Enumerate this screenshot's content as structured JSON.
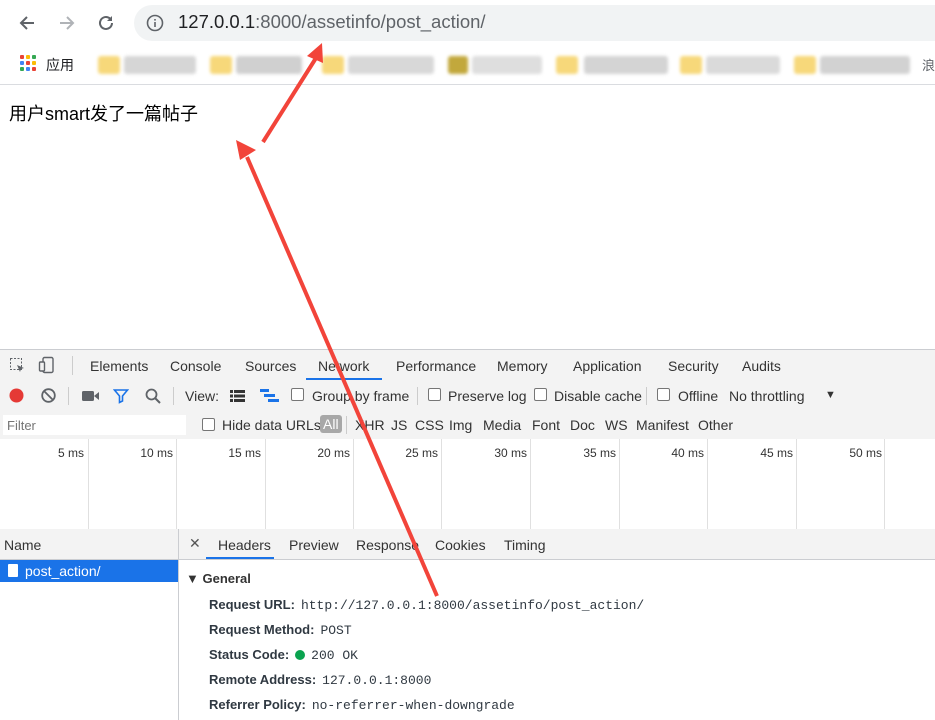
{
  "browser": {
    "url_host": "127.0.0.1",
    "url_rest": ":8000/assetinfo/post_action/",
    "apps_label": "应用",
    "bookmarks_more": "浪"
  },
  "page": {
    "text": "用户smart发了一篇帖子"
  },
  "devtools": {
    "tabs": [
      "Elements",
      "Console",
      "Sources",
      "Network",
      "Performance",
      "Memory",
      "Application",
      "Security",
      "Audits"
    ],
    "active_tab": "Network",
    "controls": {
      "view_label": "View:",
      "group_by_frame": "Group by frame",
      "preserve_log": "Preserve log",
      "disable_cache": "Disable cache",
      "offline": "Offline",
      "throttling": "No throttling"
    },
    "filter": {
      "placeholder": "Filter",
      "hide_data_urls": "Hide data URLs",
      "types": [
        "All",
        "XHR",
        "JS",
        "CSS",
        "Img",
        "Media",
        "Font",
        "Doc",
        "WS",
        "Manifest",
        "Other"
      ],
      "active_type": "All"
    },
    "timeline_ticks": [
      "5 ms",
      "10 ms",
      "15 ms",
      "20 ms",
      "25 ms",
      "30 ms",
      "35 ms",
      "40 ms",
      "45 ms",
      "50 ms"
    ],
    "name_header": "Name",
    "selected_request": "post_action/",
    "detail_tabs": [
      "Headers",
      "Preview",
      "Response",
      "Cookies",
      "Timing"
    ],
    "active_detail_tab": "Headers",
    "general_title": "General",
    "general": [
      {
        "key": "Request URL:",
        "value": "http://127.0.0.1:8000/assetinfo/post_action/"
      },
      {
        "key": "Request Method:",
        "value": "POST"
      },
      {
        "key": "Status Code:",
        "value": "200 OK"
      },
      {
        "key": "Remote Address:",
        "value": "127.0.0.1:8000"
      },
      {
        "key": "Referrer Policy:",
        "value": "no-referrer-when-downgrade"
      }
    ]
  },
  "colors": {
    "accent_blue": "#1a73e8",
    "record_red": "#e53935",
    "status_green": "#0aa34f",
    "annotation_arrow": "#f2443a"
  }
}
